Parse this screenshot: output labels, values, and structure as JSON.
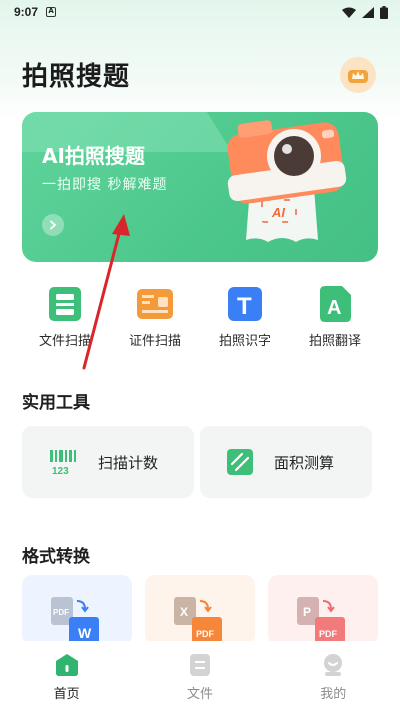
{
  "status_bar": {
    "time": "9:07",
    "notif_icon": "a-icon"
  },
  "header": {
    "title": "拍照搜题",
    "vip_icon": "crown-icon"
  },
  "banner": {
    "title": "AI拍照搜题",
    "subtitle": "一拍即搜 秒解难题",
    "camera_badge": "AI"
  },
  "quick_actions": [
    {
      "label": "文件扫描",
      "icon": "file-scan-icon",
      "color": "#3dbf7a"
    },
    {
      "label": "证件扫描",
      "icon": "id-card-icon",
      "color": "#f59a3a"
    },
    {
      "label": "拍照识字",
      "icon": "text-recognition-icon",
      "color": "#3a7ff5",
      "glyph": "T"
    },
    {
      "label": "拍照翻译",
      "icon": "translate-icon",
      "color": "#3dbf7a",
      "glyph": "A"
    }
  ],
  "tools_section": {
    "title": "实用工具",
    "items": [
      {
        "label": "扫描计数",
        "icon": "barcode-count-icon",
        "badge": "123"
      },
      {
        "label": "面积测算",
        "icon": "area-measure-icon"
      }
    ]
  },
  "format_section": {
    "title": "格式转换",
    "items": [
      {
        "icon": "pdf-to-word-icon",
        "from": "PDF",
        "to": "W",
        "bg": "#eef4ff"
      },
      {
        "icon": "excel-to-pdf-icon",
        "from": "X",
        "to": "PDF",
        "bg": "#fff4ec"
      },
      {
        "icon": "ppt-to-pdf-icon",
        "from": "P",
        "to": "PDF",
        "bg": "#fff0f0"
      }
    ]
  },
  "bottom_nav": [
    {
      "label": "首页",
      "icon": "home-icon",
      "active": true
    },
    {
      "label": "文件",
      "icon": "file-icon",
      "active": false
    },
    {
      "label": "我的",
      "icon": "profile-icon",
      "active": false
    }
  ],
  "colors": {
    "accent": "#3dbf7a",
    "banner": "#4cc78b",
    "annotation": "#d9262b"
  }
}
